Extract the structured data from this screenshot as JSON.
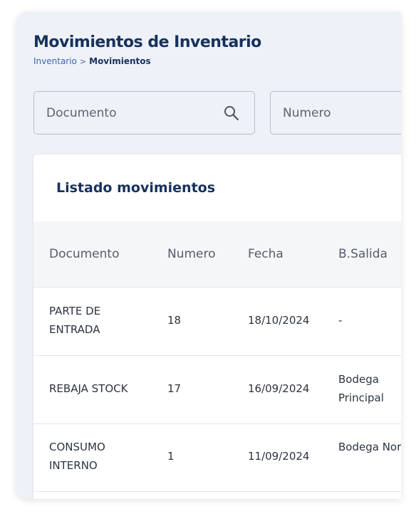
{
  "header": {
    "title": "Movimientos de Inventario",
    "breadcrumb": {
      "parent": "Inventario",
      "separator": ">",
      "current": "Movimientos"
    }
  },
  "filters": {
    "documento_placeholder": "Documento",
    "numero_placeholder": "Numero"
  },
  "card": {
    "title": "Listado movimientos"
  },
  "table": {
    "columns": [
      "Documento",
      "Numero",
      "Fecha",
      "B.Salida"
    ],
    "rows": [
      {
        "documento": "PARTE DE ENTRADA",
        "numero": "18",
        "fecha": "18/10/2024",
        "bsalida": "-"
      },
      {
        "documento": "REBAJA STOCK",
        "numero": "17",
        "fecha": "16/09/2024",
        "bsalida": "Bodega Principal"
      },
      {
        "documento": "CONSUMO INTERNO",
        "numero": "1",
        "fecha": "11/09/2024",
        "bsalida": "Bodega Norte"
      }
    ]
  },
  "colors": {
    "title": "#16325c",
    "breadcrumb_link": "#3b66b5",
    "panel_bg": "#eef1f7"
  }
}
